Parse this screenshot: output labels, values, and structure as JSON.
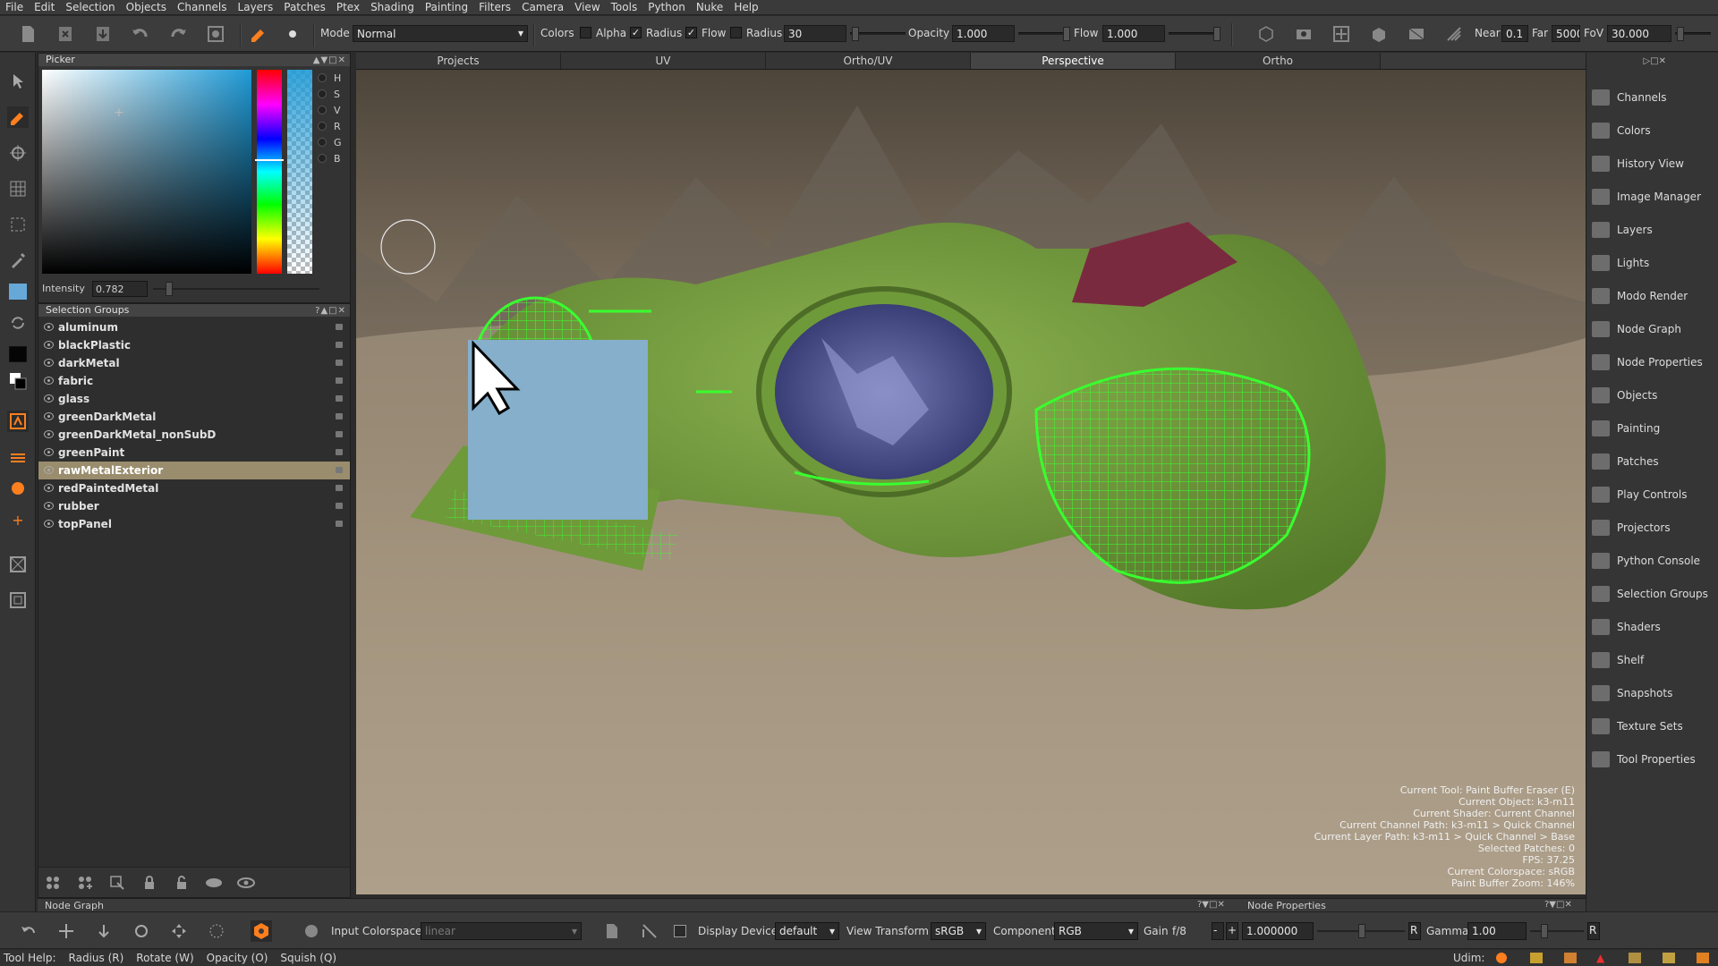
{
  "menu": [
    "File",
    "Edit",
    "Selection",
    "Objects",
    "Channels",
    "Layers",
    "Patches",
    "Ptex",
    "Shading",
    "Painting",
    "Filters",
    "Camera",
    "View",
    "Tools",
    "Python",
    "Nuke",
    "Help"
  ],
  "toolbar": {
    "mode_label": "Mode",
    "mode_value": "Normal",
    "colors_label": "Colors",
    "alpha_label": "Alpha",
    "radius_check_label": "Radius",
    "flow_check_label": "Flow",
    "radius_label": "Radius",
    "radius_value": "30",
    "opacity_label": "Opacity",
    "opacity_value": "1.000",
    "flow_label": "Flow",
    "flow_value": "1.000",
    "near_label": "Near",
    "near_value": "0.1",
    "far_label": "Far",
    "far_value": "5000",
    "fov_label": "FoV",
    "fov_value": "30.000"
  },
  "picker": {
    "title": "Picker",
    "channels": [
      "H",
      "S",
      "V",
      "R",
      "G",
      "B"
    ],
    "intensity_label": "Intensity",
    "intensity_value": "0.782"
  },
  "selection_groups": {
    "title": "Selection Groups",
    "items": [
      "aluminum",
      "blackPlastic",
      "darkMetal",
      "fabric",
      "glass",
      "greenDarkMetal",
      "greenDarkMetal_nonSubD",
      "greenPaint",
      "rawMetalExterior",
      "redPaintedMetal",
      "rubber",
      "topPanel"
    ],
    "selected": "rawMetalExterior"
  },
  "viewport_tabs": [
    "Projects",
    "UV",
    "Ortho/UV",
    "Perspective",
    "Ortho"
  ],
  "active_tab": "Perspective",
  "status_overlay": [
    "Current Tool: Paint Buffer Eraser (E)",
    "Current Object: k3-m11",
    "Current Shader: Current Channel",
    "Current Channel Path: k3-m11 > Quick Channel",
    "Current Layer Path: k3-m11 > Quick Channel > Base",
    "Selected Patches: 0",
    "FPS: 37.25",
    "Current Colorspace: sRGB",
    "Paint Buffer Zoom: 146%"
  ],
  "right_shelf": [
    "Channels",
    "Colors",
    "History View",
    "Image Manager",
    "Layers",
    "Lights",
    "Modo Render",
    "Node Graph",
    "Node Properties",
    "Objects",
    "Painting",
    "Patches",
    "Play Controls",
    "Projectors",
    "Python Console",
    "Selection Groups",
    "Shaders",
    "Shelf",
    "Snapshots",
    "Texture Sets",
    "Tool Properties"
  ],
  "bottom_headers": {
    "node_graph": "Node Graph",
    "node_properties": "Node Properties"
  },
  "bottom_bar": {
    "input_colorspace_label": "Input Colorspace",
    "input_colorspace_value": "linear",
    "display_device_label": "Display Device",
    "display_device_value": "default",
    "view_transform_label": "View Transform",
    "view_transform_value": "sRGB",
    "component_label": "Component",
    "component_value": "RGB",
    "gain_label": "Gain",
    "gain_stop": "f/8",
    "gain_value": "1.000000",
    "gain_r": "R",
    "gamma_label": "Gamma",
    "gamma_value": "1.00",
    "gamma_r": "R"
  },
  "statusbar": {
    "items": [
      "Tool Help:",
      "Radius (R)",
      "Rotate (W)",
      "Opacity (O)",
      "Squish (Q)"
    ],
    "udim_label": "Udim:"
  },
  "colors": {
    "accent_orange": "#ff7f1f",
    "wire_green": "#33ff33",
    "ship_green": "#6f9a3a",
    "panel_maroon": "#7a2a3e",
    "paint_buffer_blue": "#85afcb",
    "selection_highlight": "#9a8d6e"
  }
}
